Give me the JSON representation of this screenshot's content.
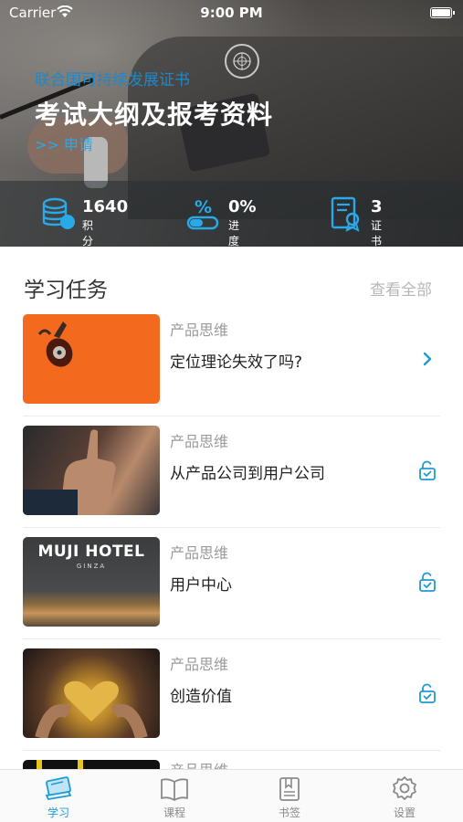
{
  "status_bar": {
    "carrier": "Carrier",
    "time": "9:00 PM"
  },
  "hero": {
    "subtitle": "联合国可持续发展证书",
    "title": "考试大纲及报考资料",
    "apply_link": ">> 申请"
  },
  "stats": [
    {
      "value": "1640",
      "label": "积分",
      "icon": "database-icon"
    },
    {
      "value": "0%",
      "label": "进度",
      "icon": "percent-toggle-icon"
    },
    {
      "value": "3",
      "label": "证书",
      "icon": "certificate-icon"
    }
  ],
  "section": {
    "title": "学习任务",
    "view_all": "查看全部"
  },
  "tasks": [
    {
      "category": "产品思维",
      "title": "定位理论失效了吗?",
      "action_icon": "chevron-right-icon"
    },
    {
      "category": "产品思维",
      "title": "从产品公司到用户公司",
      "action_icon": "unlock-icon"
    },
    {
      "category": "产品思维",
      "title": "用户中心",
      "action_icon": "unlock-icon",
      "thumb_text": "MUJI HOTEL",
      "thumb_sub": "GINZA"
    },
    {
      "category": "产品思维",
      "title": "创造价值",
      "action_icon": "unlock-icon"
    }
  ],
  "partial_task": {
    "category": "产品思维"
  },
  "tabbar": [
    {
      "label": "学习",
      "icon": "book-stack-icon",
      "active": true
    },
    {
      "label": "课程",
      "icon": "open-book-icon",
      "active": false
    },
    {
      "label": "书签",
      "icon": "bookmark-icon",
      "active": false
    },
    {
      "label": "设置",
      "icon": "gear-icon",
      "active": false
    }
  ],
  "colors": {
    "accent": "#1e9ad6",
    "hero_subtitle": "#1e88c9",
    "muted": "#9a9a9a"
  }
}
